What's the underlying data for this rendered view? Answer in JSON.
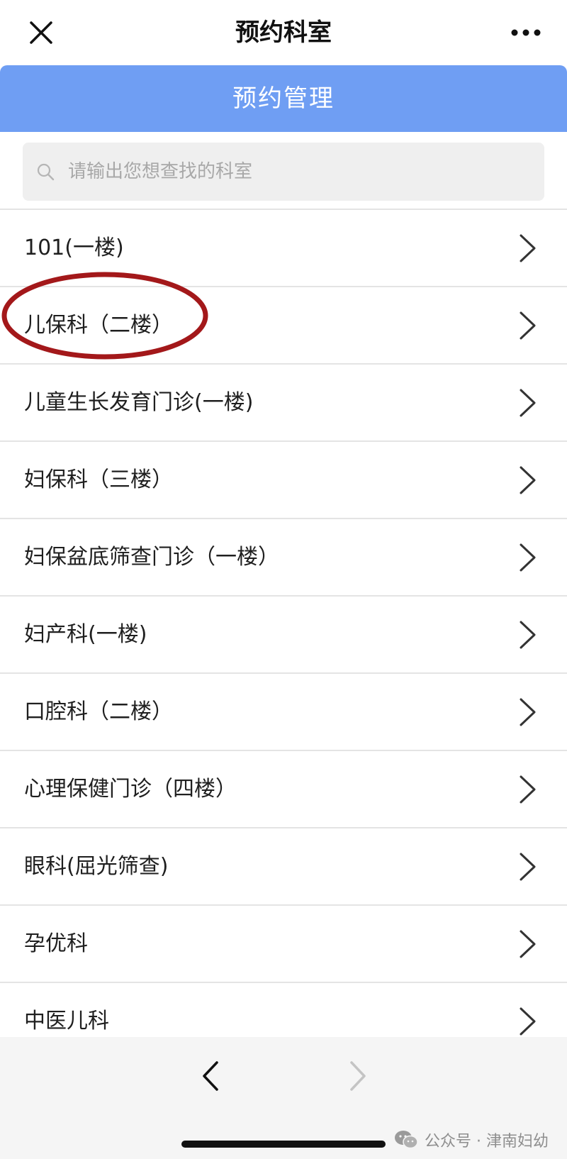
{
  "titlebar": {
    "title": "预约科室"
  },
  "header": {
    "label": "预约管理",
    "color": "#6f9ef3"
  },
  "search": {
    "placeholder": "请输出您想查找的科室",
    "value": ""
  },
  "departments": [
    {
      "label": "101(一楼)"
    },
    {
      "label": "儿保科（二楼）",
      "highlighted": true
    },
    {
      "label": "儿童生长发育门诊(一楼)"
    },
    {
      "label": "妇保科（三楼）"
    },
    {
      "label": "妇保盆底筛查门诊（一楼）"
    },
    {
      "label": "妇产科(一楼)"
    },
    {
      "label": "口腔科（二楼）"
    },
    {
      "label": "心理保健门诊（四楼）"
    },
    {
      "label": "眼科(屈光筛查)"
    },
    {
      "label": "孕优科"
    },
    {
      "label": "中医儿科"
    }
  ],
  "highlight": {
    "color": "#a3181a"
  },
  "icons": {
    "close": "close-icon",
    "more": "more-icon",
    "search": "search-icon",
    "chevron": "chevron-right-icon",
    "back": "chevron-left-icon",
    "forward": "chevron-right-icon",
    "wechat": "wechat-icon"
  },
  "watermark": {
    "text": "公众号 · 津南妇幼"
  }
}
